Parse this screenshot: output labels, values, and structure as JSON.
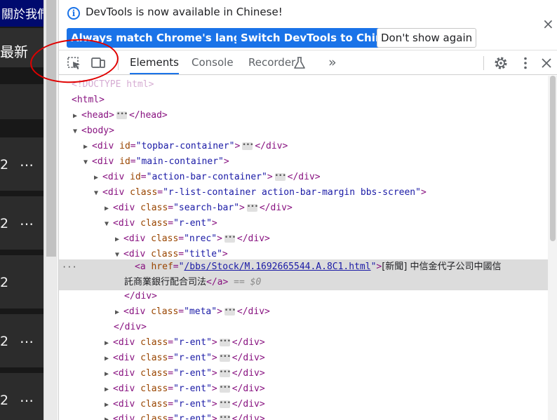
{
  "page": {
    "top_link": "關於我們",
    "active_tab": "最新",
    "rows": [
      {
        "num": "2",
        "more": "…"
      },
      {
        "num": "2",
        "more": "…"
      },
      {
        "num": "2",
        "more": ""
      },
      {
        "num": "2",
        "more": "…"
      },
      {
        "num": "2",
        "more": "…"
      }
    ]
  },
  "banner": {
    "icon": "info-icon",
    "message": "DevTools is now available in Chinese!",
    "btn_match": "Always match Chrome's language",
    "btn_switch": "Switch DevTools to Chinese",
    "btn_dont_show": "Don't show again",
    "close": "×"
  },
  "tabbar": {
    "tabs": [
      "Elements",
      "Console",
      "Recorder",
      "»"
    ],
    "active": "Elements",
    "icons": [
      "inspect-element-icon",
      "device-toolbar-icon",
      "flask-icon",
      "gear-icon",
      "kebab-menu-icon",
      "close-icon"
    ]
  },
  "annotation": {
    "color": "#e00000",
    "shape": "hand-drawn-ellipse"
  },
  "elements": {
    "doctype": "<!DOCTYPE html>",
    "html_open": "<html>",
    "head_open": "<head>",
    "head_close": "</head>",
    "body_open": "<body>",
    "div_open": "<div",
    "div_close": "</div>",
    "close_gt": ">",
    "id_attr": "id",
    "class_attr": "class",
    "href_attr": "href",
    "eq": "=",
    "topbar_id": "\"topbar-container\"",
    "main_id": "\"main-container\"",
    "action_id": "\"action-bar-container\"",
    "rlist_class": "\"r-list-container action-bar-margin bbs-screen\"",
    "search_class": "\"search-bar\"",
    "rent_class": "\"r-ent\"",
    "nrec_class": "\"nrec\"",
    "title_class": "\"title\"",
    "meta_class": "\"meta\"",
    "a_open": "<a",
    "quote": "\"",
    "link_href": "/bbs/Stock/M.1692665544.A.8C1.html",
    "link_text_1": "[新聞] 中信金代子公司中國信",
    "link_text_2": "託商業銀行配合司法",
    "a_close": "</a>",
    "selected_marker": "== $0",
    "gutter_dots": "···"
  },
  "colors": {
    "accent": "#1a73e8",
    "tag": "#881280",
    "attr_name": "#994500",
    "attr_value": "#1a1aa6"
  }
}
